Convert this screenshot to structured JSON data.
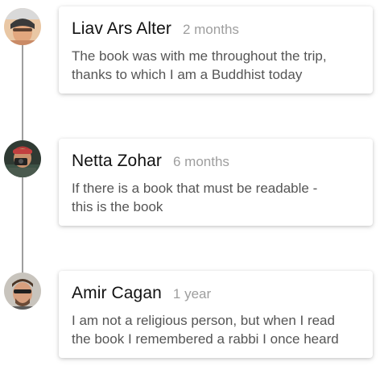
{
  "reviews": [
    {
      "author": "Liav Ars Alter",
      "time": "2 months",
      "text_line1": "The book was with me throughout the trip,",
      "text_line2": "thanks to which I am a Buddhist today"
    },
    {
      "author": "Netta Zohar",
      "time": "6 months",
      "text_line1": "If there is a book that must be readable -",
      "text_line2": "this is the book"
    },
    {
      "author": "Amir Cagan",
      "time": "1 year",
      "text_line1": "I am not a religious person, but when I read",
      "text_line2": "the book I remembered a rabbi I once heard"
    }
  ],
  "colors": {
    "timeline": "#9e9e9e",
    "name": "#111111",
    "time": "#9e9e9e",
    "text": "#555555"
  }
}
